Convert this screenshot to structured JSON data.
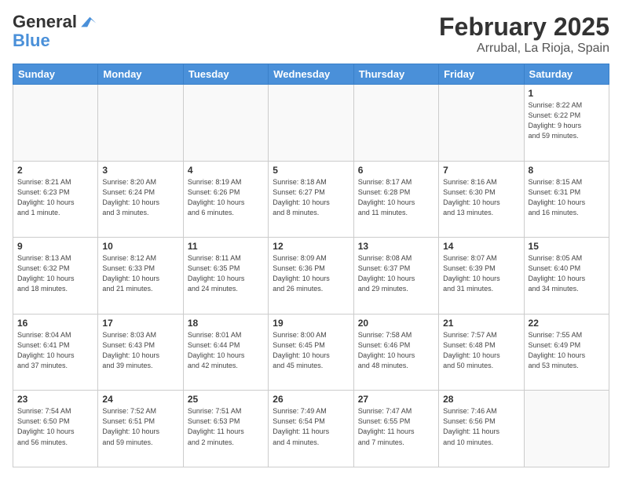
{
  "logo": {
    "line1": "General",
    "line2": "Blue"
  },
  "title": "February 2025",
  "subtitle": "Arrubal, La Rioja, Spain",
  "days_header": [
    "Sunday",
    "Monday",
    "Tuesday",
    "Wednesday",
    "Thursday",
    "Friday",
    "Saturday"
  ],
  "weeks": [
    [
      {
        "num": "",
        "info": ""
      },
      {
        "num": "",
        "info": ""
      },
      {
        "num": "",
        "info": ""
      },
      {
        "num": "",
        "info": ""
      },
      {
        "num": "",
        "info": ""
      },
      {
        "num": "",
        "info": ""
      },
      {
        "num": "1",
        "info": "Sunrise: 8:22 AM\nSunset: 6:22 PM\nDaylight: 9 hours\nand 59 minutes."
      }
    ],
    [
      {
        "num": "2",
        "info": "Sunrise: 8:21 AM\nSunset: 6:23 PM\nDaylight: 10 hours\nand 1 minute."
      },
      {
        "num": "3",
        "info": "Sunrise: 8:20 AM\nSunset: 6:24 PM\nDaylight: 10 hours\nand 3 minutes."
      },
      {
        "num": "4",
        "info": "Sunrise: 8:19 AM\nSunset: 6:26 PM\nDaylight: 10 hours\nand 6 minutes."
      },
      {
        "num": "5",
        "info": "Sunrise: 8:18 AM\nSunset: 6:27 PM\nDaylight: 10 hours\nand 8 minutes."
      },
      {
        "num": "6",
        "info": "Sunrise: 8:17 AM\nSunset: 6:28 PM\nDaylight: 10 hours\nand 11 minutes."
      },
      {
        "num": "7",
        "info": "Sunrise: 8:16 AM\nSunset: 6:30 PM\nDaylight: 10 hours\nand 13 minutes."
      },
      {
        "num": "8",
        "info": "Sunrise: 8:15 AM\nSunset: 6:31 PM\nDaylight: 10 hours\nand 16 minutes."
      }
    ],
    [
      {
        "num": "9",
        "info": "Sunrise: 8:13 AM\nSunset: 6:32 PM\nDaylight: 10 hours\nand 18 minutes."
      },
      {
        "num": "10",
        "info": "Sunrise: 8:12 AM\nSunset: 6:33 PM\nDaylight: 10 hours\nand 21 minutes."
      },
      {
        "num": "11",
        "info": "Sunrise: 8:11 AM\nSunset: 6:35 PM\nDaylight: 10 hours\nand 24 minutes."
      },
      {
        "num": "12",
        "info": "Sunrise: 8:09 AM\nSunset: 6:36 PM\nDaylight: 10 hours\nand 26 minutes."
      },
      {
        "num": "13",
        "info": "Sunrise: 8:08 AM\nSunset: 6:37 PM\nDaylight: 10 hours\nand 29 minutes."
      },
      {
        "num": "14",
        "info": "Sunrise: 8:07 AM\nSunset: 6:39 PM\nDaylight: 10 hours\nand 31 minutes."
      },
      {
        "num": "15",
        "info": "Sunrise: 8:05 AM\nSunset: 6:40 PM\nDaylight: 10 hours\nand 34 minutes."
      }
    ],
    [
      {
        "num": "16",
        "info": "Sunrise: 8:04 AM\nSunset: 6:41 PM\nDaylight: 10 hours\nand 37 minutes."
      },
      {
        "num": "17",
        "info": "Sunrise: 8:03 AM\nSunset: 6:43 PM\nDaylight: 10 hours\nand 39 minutes."
      },
      {
        "num": "18",
        "info": "Sunrise: 8:01 AM\nSunset: 6:44 PM\nDaylight: 10 hours\nand 42 minutes."
      },
      {
        "num": "19",
        "info": "Sunrise: 8:00 AM\nSunset: 6:45 PM\nDaylight: 10 hours\nand 45 minutes."
      },
      {
        "num": "20",
        "info": "Sunrise: 7:58 AM\nSunset: 6:46 PM\nDaylight: 10 hours\nand 48 minutes."
      },
      {
        "num": "21",
        "info": "Sunrise: 7:57 AM\nSunset: 6:48 PM\nDaylight: 10 hours\nand 50 minutes."
      },
      {
        "num": "22",
        "info": "Sunrise: 7:55 AM\nSunset: 6:49 PM\nDaylight: 10 hours\nand 53 minutes."
      }
    ],
    [
      {
        "num": "23",
        "info": "Sunrise: 7:54 AM\nSunset: 6:50 PM\nDaylight: 10 hours\nand 56 minutes."
      },
      {
        "num": "24",
        "info": "Sunrise: 7:52 AM\nSunset: 6:51 PM\nDaylight: 10 hours\nand 59 minutes."
      },
      {
        "num": "25",
        "info": "Sunrise: 7:51 AM\nSunset: 6:53 PM\nDaylight: 11 hours\nand 2 minutes."
      },
      {
        "num": "26",
        "info": "Sunrise: 7:49 AM\nSunset: 6:54 PM\nDaylight: 11 hours\nand 4 minutes."
      },
      {
        "num": "27",
        "info": "Sunrise: 7:47 AM\nSunset: 6:55 PM\nDaylight: 11 hours\nand 7 minutes."
      },
      {
        "num": "28",
        "info": "Sunrise: 7:46 AM\nSunset: 6:56 PM\nDaylight: 11 hours\nand 10 minutes."
      },
      {
        "num": "",
        "info": ""
      }
    ]
  ]
}
